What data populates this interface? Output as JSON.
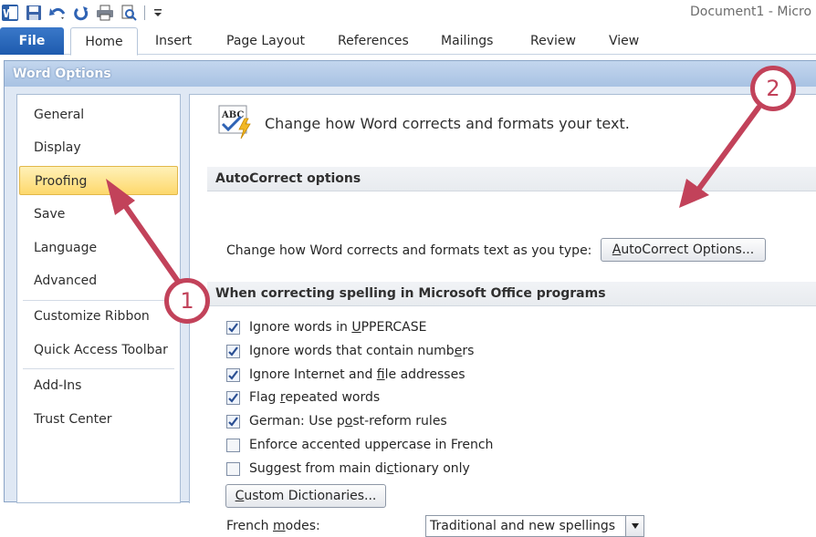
{
  "window": {
    "title": "Document1 - Micro",
    "app_icon": "word-icon",
    "qat_icons": [
      "save-icon",
      "undo-icon",
      "redo-icon",
      "print-icon",
      "print-preview-icon",
      "qat-customize-icon"
    ]
  },
  "ribbon": {
    "tabs": [
      {
        "label": "File"
      },
      {
        "label": "Home"
      },
      {
        "label": "Insert"
      },
      {
        "label": "Page Layout"
      },
      {
        "label": "References"
      },
      {
        "label": "Mailings"
      },
      {
        "label": "Review"
      },
      {
        "label": "View"
      }
    ],
    "active_tab": "Home"
  },
  "dialog": {
    "title": "Word Options",
    "nav": [
      {
        "label": "General"
      },
      {
        "label": "Display"
      },
      {
        "label": "Proofing"
      },
      {
        "label": "Save"
      },
      {
        "label": "Language"
      },
      {
        "label": "Advanced"
      },
      {
        "label": "Customize Ribbon"
      },
      {
        "label": "Quick Access Toolbar"
      },
      {
        "label": "Add-Ins"
      },
      {
        "label": "Trust Center"
      }
    ],
    "selected_nav": "Proofing",
    "header": {
      "icon": "spelling-abc-icon",
      "icon_text": "ABC",
      "text": "Change how Word corrects and formats your text."
    },
    "autocorrect_section": {
      "title": "AutoCorrect options",
      "label": "Change how Word corrects and formats text as you type:",
      "button": {
        "pre": "",
        "u": "A",
        "post": "utoCorrect Options..."
      }
    },
    "spelling_section": {
      "title": "When correcting spelling in Microsoft Office programs",
      "options": [
        {
          "pre": "Ignore words in ",
          "u": "U",
          "post": "PPERCASE",
          "checked": true
        },
        {
          "pre": "Ignore words that contain numb",
          "u": "e",
          "post": "rs",
          "checked": true
        },
        {
          "pre": "Ignore Internet and ",
          "u": "f",
          "post": "ile addresses",
          "checked": true
        },
        {
          "pre": "Flag ",
          "u": "r",
          "post": "epeated words",
          "checked": true
        },
        {
          "pre": "German: Use p",
          "u": "o",
          "post": "st-reform rules",
          "checked": true
        },
        {
          "pre": "Enforce accented uppercase in French",
          "u": "",
          "post": "",
          "checked": false
        },
        {
          "pre": "Suggest from main di",
          "u": "c",
          "post": "tionary only",
          "checked": false
        }
      ],
      "custom_dictionaries_button": {
        "pre": "",
        "u": "C",
        "post": "ustom Dictionaries..."
      },
      "french_modes": {
        "label_pre": "French ",
        "label_u": "m",
        "label_post": "odes:",
        "value": "Traditional and new spellings"
      }
    }
  },
  "annotations": [
    {
      "number": "1"
    },
    {
      "number": "2"
    }
  ],
  "colors": {
    "accent_file_tab": "#1e5bae",
    "selected_nav": "#fdd86c",
    "annotation": "#c2425a"
  }
}
